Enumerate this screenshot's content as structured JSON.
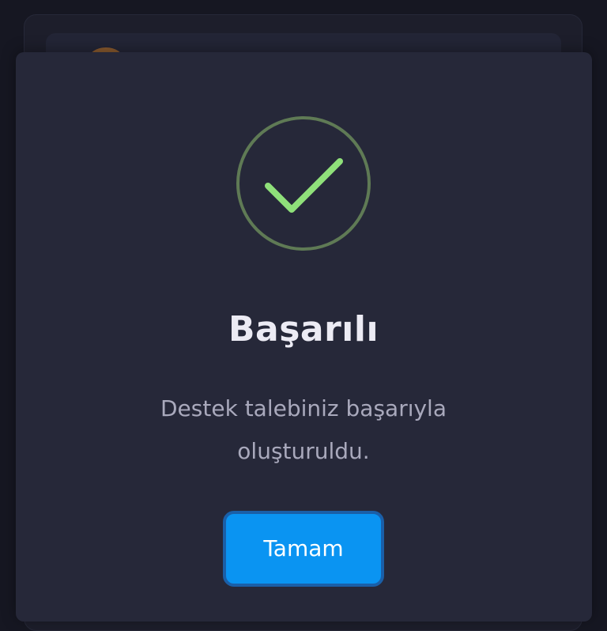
{
  "dialog": {
    "title": "Başarılı",
    "message": "Destek talebiniz başarıyla oluşturuldu.",
    "ok_label": "Tamam",
    "icon": "check-circle-icon"
  },
  "colors": {
    "background": "#161722",
    "modal": "#262839",
    "success_ring": "#5f7a55",
    "success_check": "#8fe07a",
    "button": "#0a94f2",
    "title_text": "#ecebf4",
    "message_text": "#a9a9bc"
  }
}
